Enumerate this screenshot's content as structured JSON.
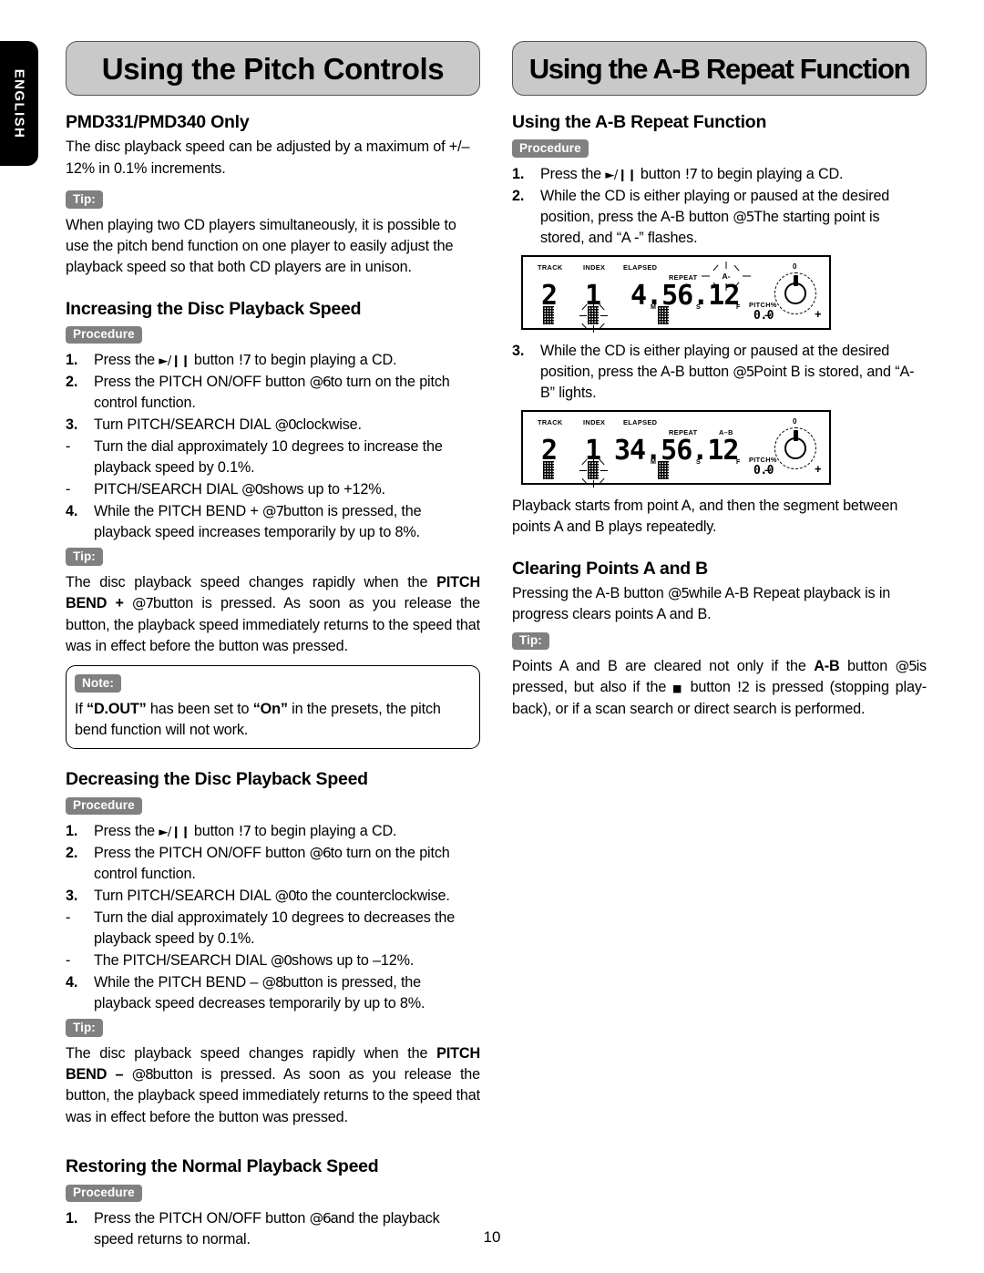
{
  "lang_tab": {
    "label": "ENGLISH"
  },
  "page_number": "10",
  "colors": {
    "banner_fill": "#c9c9c9",
    "banner_border": "#555555",
    "badge_fill": "#808080",
    "badge_text": "#ffffff",
    "tab_fill": "#000000",
    "text": "#000000"
  },
  "left_column": {
    "banner": "Using the Pitch Controls",
    "heading_model": "PMD331/PMD340 Only",
    "intro": "The disc playback speed can be adjusted by a maximum of +/– 12% in 0.1% increments.",
    "tip1_badge": "Tip:",
    "tip1_text": "When playing two CD players simultaneously, it is possible to use the pitch bend function on one player to easily adjust the playback speed so that both CD players are in unison.",
    "increasing": {
      "heading": "Increasing the Disc Playback Speed",
      "procedure_badge": "Procedure",
      "steps": [
        {
          "num": "1.",
          "pre": "Press the ",
          "glyph": "play-pause",
          "post_a": " button ",
          "ref": "!7",
          "post_b": " to begin playing a CD."
        },
        {
          "num": "2.",
          "pre": "Press the PITCH ON/OFF button ",
          "ref": "@6",
          "post_b": "to turn on the pitch control function."
        },
        {
          "num": "3.",
          "pre": "Turn PITCH/SEARCH DIAL ",
          "ref": "@0",
          "post_b": "clockwise."
        },
        {
          "num": "-",
          "pre": "Turn the dial approximately 10 degrees to increase the playback speed by 0.1%.",
          "ref": "",
          "post_b": ""
        },
        {
          "num": "-",
          "pre": "PITCH/SEARCH DIAL ",
          "ref": "@0",
          "post_b": "shows up to +12%."
        },
        {
          "num": "4.",
          "pre": "While the PITCH BEND + ",
          "ref": "@7",
          "post_b": "button is pressed, the playback speed increases temporarily by up to 8%."
        }
      ],
      "tip_badge": "Tip:",
      "tip_parts": {
        "a": "The disc playback speed changes rapidly when the ",
        "bold1": "PITCH BEND + ",
        "ref": "@7",
        "b": "button is pressed.  As soon as you release the button, the playback speed immediately returns to the speed that was in effect before the button was pressed."
      },
      "note_badge": "Note:",
      "note_parts": {
        "a": "If ",
        "bold1": "“D.OUT”",
        "b": " has been set to ",
        "bold2": "“On”",
        "c": " in the presets, the pitch bend function will not work."
      }
    },
    "decreasing": {
      "heading": "Decreasing the Disc Playback Speed",
      "procedure_badge": "Procedure",
      "steps": [
        {
          "num": "1.",
          "pre": "Press the ",
          "glyph": "play-pause",
          "post_a": " button ",
          "ref": "!7",
          "post_b": " to begin playing a CD."
        },
        {
          "num": "2.",
          "pre": "Press the PITCH ON/OFF button ",
          "ref": "@6",
          "post_b": "to turn on the pitch control function."
        },
        {
          "num": "3.",
          "pre": "Turn PITCH/SEARCH DIAL ",
          "ref": "@0",
          "post_b": "to the counterclockwise."
        },
        {
          "num": "-",
          "pre": "Turn the dial approximately 10 degrees to decreases the playback speed by 0.1%.",
          "ref": "",
          "post_b": ""
        },
        {
          "num": "-",
          "pre": "The PITCH/SEARCH DIAL ",
          "ref": "@0",
          "post_b": "shows up to –12%."
        },
        {
          "num": "4.",
          "pre": "While the PITCH BEND – ",
          "ref": "@8",
          "post_b": "button is pressed, the playback speed decreases temporarily by up to 8%."
        }
      ],
      "tip_badge": "Tip:",
      "tip_parts": {
        "a": "The disc playback speed changes rapidly when the ",
        "bold1": "PITCH BEND – ",
        "ref": "@8",
        "b": "button is pressed.  As soon as you release the button, the playback speed immediately returns to the speed that was in effect before the button was pressed."
      }
    },
    "restoring": {
      "heading": "Restoring the Normal Playback Speed",
      "procedure_badge": "Procedure",
      "steps": [
        {
          "num": "1.",
          "pre": "Press the PITCH ON/OFF button ",
          "ref": "@6",
          "post_b": "and the playback speed returns to normal."
        }
      ]
    }
  },
  "right_column": {
    "banner": "Using the A-B Repeat Function",
    "section1": {
      "heading": "Using the A-B Repeat Function",
      "procedure_badge": "Procedure",
      "step1": {
        "num": "1.",
        "pre": "Press the ",
        "glyph": "play-pause",
        "post_a": " button ",
        "ref": "!7",
        "post_b": " to begin playing a CD."
      },
      "step2": {
        "num": "2.",
        "pre": "While the CD is either playing or paused at the desired position, press the A-B button ",
        "ref": "@5",
        "post_b": "The starting point is stored, and “A -” flashes."
      },
      "step3": {
        "num": "3.",
        "pre": "While the CD is either playing or paused at the desired position, press the A-B button ",
        "ref": "@5",
        "post_b": "Point B is stored, and “A-B” lights."
      },
      "after_text": "Playback starts from point A, and then the segment between points A and B plays repeatedly."
    },
    "section2": {
      "heading": "Clearing Points A and B",
      "para_parts": {
        "a": "Pressing the A-B button ",
        "ref": "@5",
        "b": "while A-B Repeat playback is in progress clears points A and B."
      },
      "tip_badge": "Tip:",
      "tip_parts": {
        "a": "Points A and B are cleared not only if the ",
        "bold1": "A-B",
        "b": " button ",
        "ref1": "@5",
        "c": "is pressed, but also if the ",
        "glyph": "stop",
        "d": " button ",
        "ref2": "!2",
        "e": " is pressed (stopping play-back), or if a scan search or direct search is performed."
      }
    },
    "lcd_displays": [
      {
        "labels": {
          "track": "TRACK",
          "index": "INDEX",
          "elapsed": "ELAPSED",
          "repeat": "REPEAT",
          "pitch_pct": "PITCH%"
        },
        "track_value": "2",
        "index_value": "1",
        "time_value": "4.56.12",
        "time_units": {
          "m": "M",
          "s": "S",
          "f": "F"
        },
        "ab_indicator": "A-",
        "ab_state": "flashing",
        "pitch_value": "0.0",
        "dial_zero": "0",
        "dial_minus": "–",
        "dial_plus": "+"
      },
      {
        "labels": {
          "track": "TRACK",
          "index": "INDEX",
          "elapsed": "ELAPSED",
          "repeat": "REPEAT",
          "pitch_pct": "PITCH%"
        },
        "track_value": "2",
        "index_value": "1",
        "time_value": "34.56.12",
        "time_units": {
          "m": "M",
          "s": "S",
          "f": "F"
        },
        "ab_indicator": "A–B",
        "ab_state": "lit",
        "pitch_value": "0.0",
        "dial_zero": "0",
        "dial_minus": "–",
        "dial_plus": "+"
      }
    ]
  }
}
